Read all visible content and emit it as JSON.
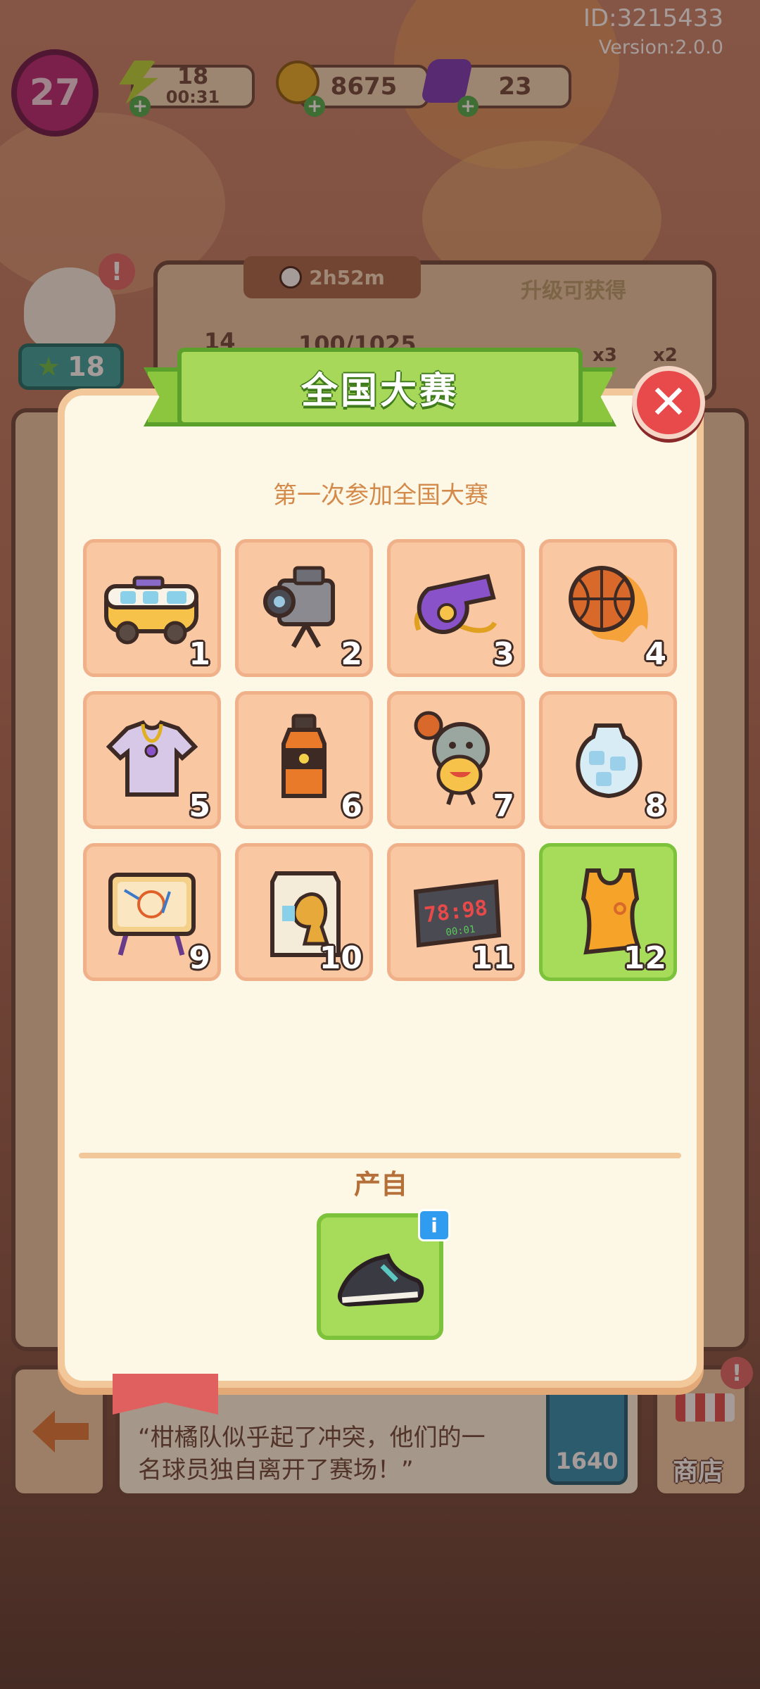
{
  "header": {
    "player_id": "ID:3215433",
    "version": "Version:2.0.0",
    "level": "27",
    "energy": "18",
    "energy_timer": "00:31",
    "coins": "8675",
    "gems": "23"
  },
  "background": {
    "event_timer": "2h52m",
    "progress_text": "100/1025",
    "progress_level": "14",
    "upgrade_rewards_title": "升级可获得",
    "reward_multiplier_1": "x3",
    "reward_multiplier_2": "x2",
    "mascot_stars": "18"
  },
  "dialog": {
    "title": "全国大赛",
    "subtitle": "第一次参加全国大赛",
    "source_label": "产自",
    "items": [
      {
        "num": "1",
        "icon": "van-icon"
      },
      {
        "num": "2",
        "icon": "video-camera-icon"
      },
      {
        "num": "3",
        "icon": "whistle-icon"
      },
      {
        "num": "4",
        "icon": "flaming-basketball-icon"
      },
      {
        "num": "5",
        "icon": "jersey-shirt-icon"
      },
      {
        "num": "6",
        "icon": "sports-drink-icon"
      },
      {
        "num": "7",
        "icon": "mascot-fish-icon"
      },
      {
        "num": "8",
        "icon": "ice-bag-icon"
      },
      {
        "num": "9",
        "icon": "tactics-board-icon"
      },
      {
        "num": "10",
        "icon": "trophy-box-icon"
      },
      {
        "num": "11",
        "icon": "scoreboard-icon"
      },
      {
        "num": "12",
        "icon": "basketball-jersey-icon"
      }
    ],
    "selected_item": "12",
    "scoreboard_big": "78:98",
    "scoreboard_small": "00:01",
    "source_icon": "sneaker-icon"
  },
  "bottom": {
    "story_line1": "“柑橘队似乎起了冲突，他们的一",
    "story_line2": "名球员独自离开了赛场！”",
    "coin_cost": "1640",
    "shop_label": "商店"
  },
  "colors": {
    "dialog_bg": "#fdf7e6",
    "tile_bg": "#f9c7a2",
    "tile_active": "#a6dc5a",
    "banner_green": "#a8d85a",
    "close_red": "#e8494a",
    "subtitle_orange": "#d38a4a"
  }
}
